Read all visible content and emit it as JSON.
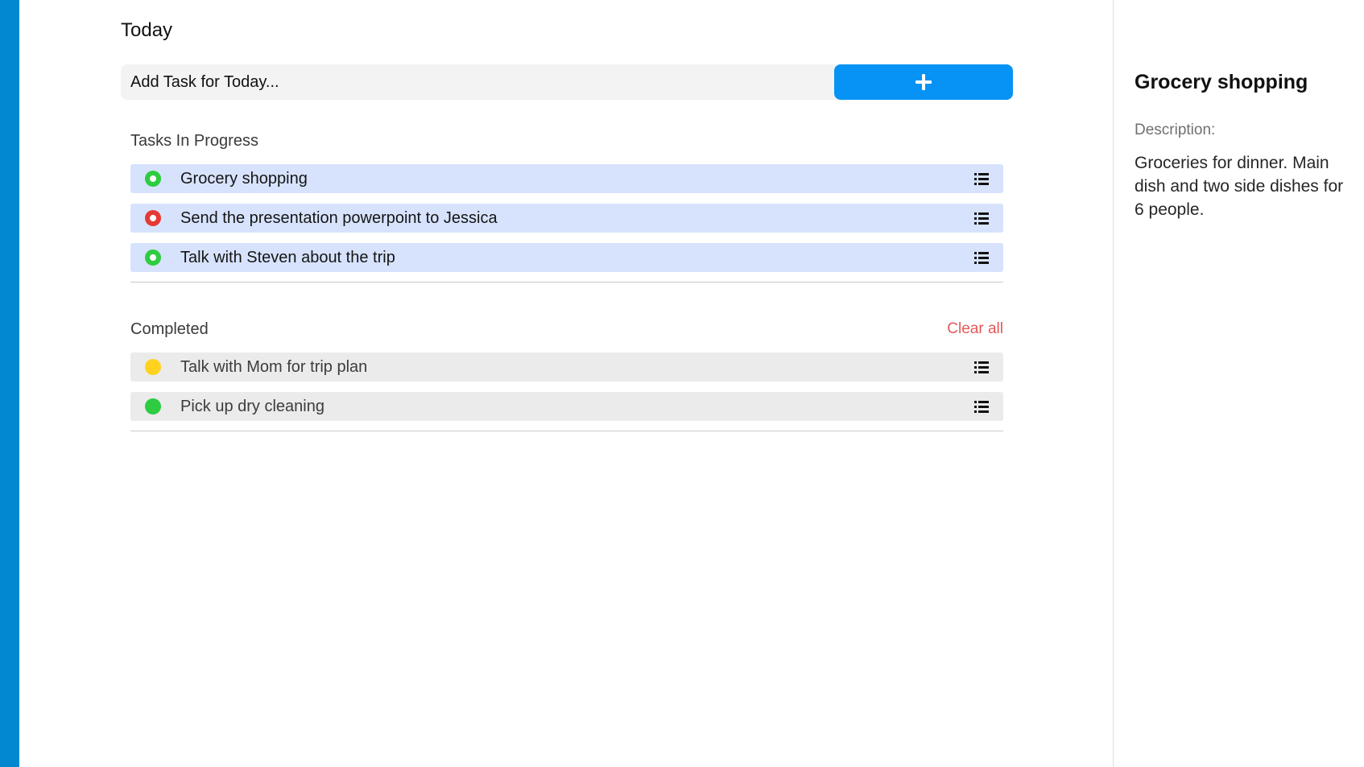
{
  "main": {
    "title": "Today",
    "add_task": {
      "placeholder": "Add Task for Today...",
      "button_icon": "plus-icon"
    },
    "in_progress": {
      "label": "Tasks In Progress",
      "tasks": [
        {
          "label": "Grocery shopping",
          "status_color": "#2ecc40",
          "dot_style": "ring"
        },
        {
          "label": "Send the presentation powerpoint to Jessica",
          "status_color": "#e53935",
          "dot_style": "ring"
        },
        {
          "label": "Talk with Steven about the trip",
          "status_color": "#2ecc40",
          "dot_style": "ring"
        }
      ]
    },
    "completed": {
      "label": "Completed",
      "clear_all_label": "Clear all",
      "tasks": [
        {
          "label": "Talk with Mom for trip plan",
          "status_color": "#ffd21f",
          "dot_style": "solid"
        },
        {
          "label": "Pick up dry cleaning",
          "status_color": "#2ecc40",
          "dot_style": "solid"
        }
      ]
    }
  },
  "details": {
    "title": "Grocery shopping",
    "description_label": "Description:",
    "description_text": "Groceries for dinner. Main dish and two side dishes for 6 people."
  },
  "theme": {
    "accent": "#0693f5",
    "sidebar_strip": "#0288d1",
    "progress_row_bg": "#d7e3fd",
    "completed_row_bg": "#ebebeb",
    "clear_all_color": "#e45858"
  }
}
